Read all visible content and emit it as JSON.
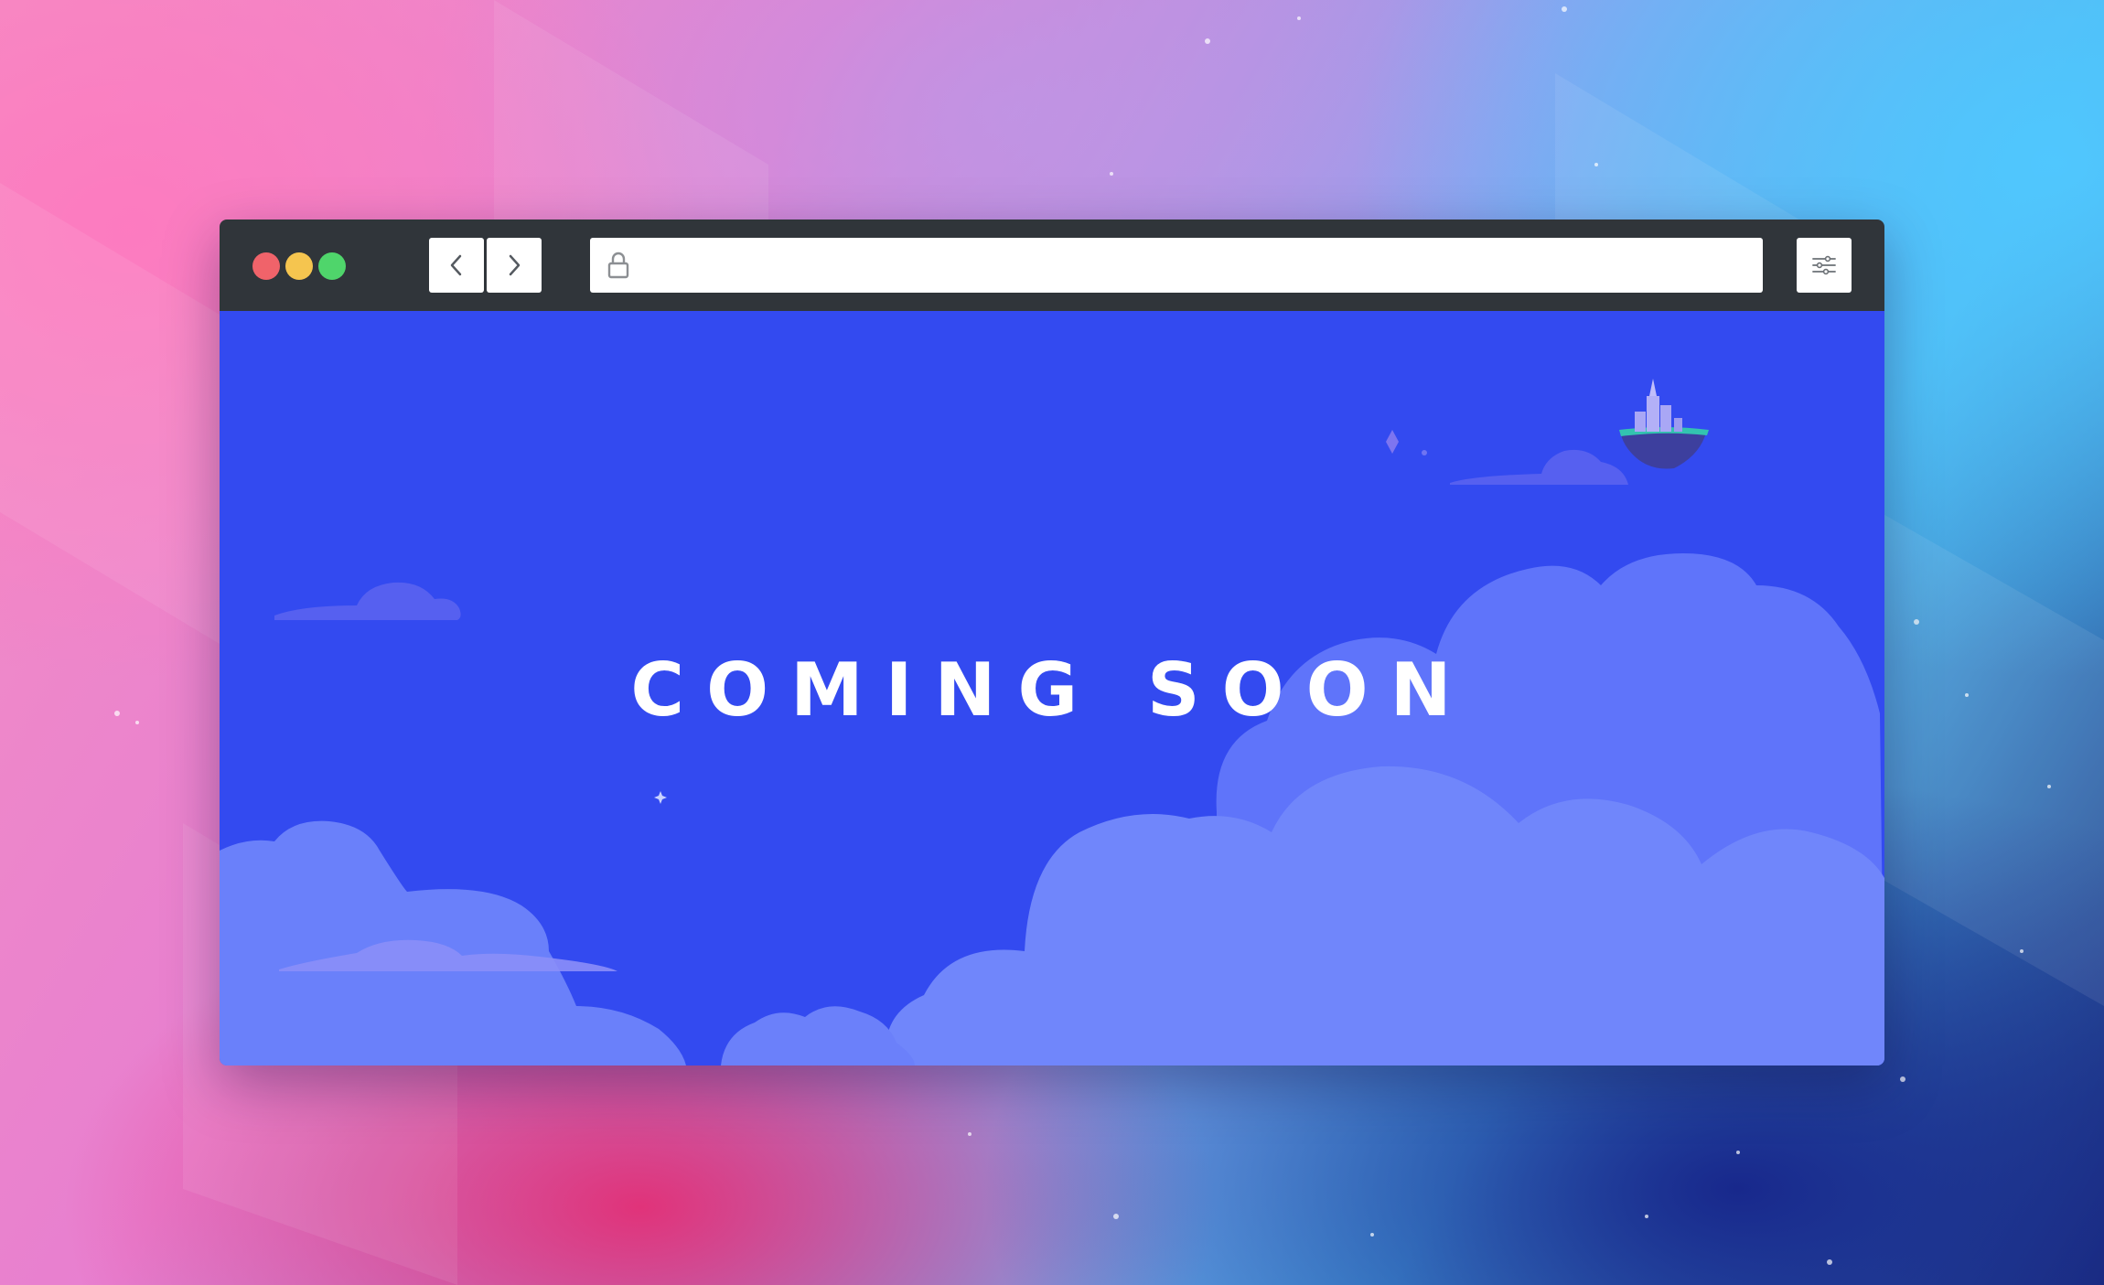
{
  "page": {
    "headline": "COMING SOON"
  },
  "browser": {
    "address_bar": {
      "value": "",
      "placeholder": ""
    },
    "controls": {
      "traffic_lights": [
        "close",
        "minimize",
        "zoom"
      ],
      "back_icon": "chevron-left-icon",
      "forward_icon": "chevron-right-icon",
      "lock_icon": "lock-icon",
      "menu_icon": "sliders-icon"
    }
  },
  "colors": {
    "chrome": "#30353a",
    "page_background": "#334af0",
    "cloud": "#7086fb",
    "traffic_red": "#f0636a",
    "traffic_yellow": "#f5c54f",
    "traffic_green": "#4fd56b"
  }
}
